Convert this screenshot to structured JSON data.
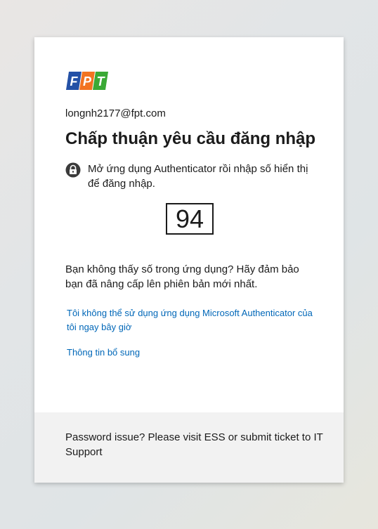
{
  "brand": {
    "logo_text": "FPT",
    "colors": {
      "blue": "#2451a6",
      "orange": "#f27321",
      "green": "#3aa935"
    }
  },
  "identity": {
    "email": "longnh2177@fpt.com"
  },
  "heading": {
    "title": "Chấp thuận yêu cầu đăng nhập"
  },
  "info": {
    "icon": "lock-icon",
    "text": "Mở ứng dụng Authenticator rồi nhập số hiển thị để đăng nhập."
  },
  "number_match": {
    "value": "94"
  },
  "hint": {
    "text": "Bạn không thấy số trong ứng dụng? Hãy đảm bảo bạn đã nâng cấp lên phiên bản mới nhất."
  },
  "links": {
    "cant_use": "Tôi không thể sử dụng ứng dụng Microsoft Authenticator của tôi ngay bây giờ",
    "more_info": "Thông tin bổ sung"
  },
  "footer": {
    "text": "Password issue? Please visit ESS or submit ticket to IT Support"
  },
  "colors": {
    "link": "#0067b8",
    "text": "#1b1b1b",
    "footer_bg": "#f2f2f2"
  }
}
